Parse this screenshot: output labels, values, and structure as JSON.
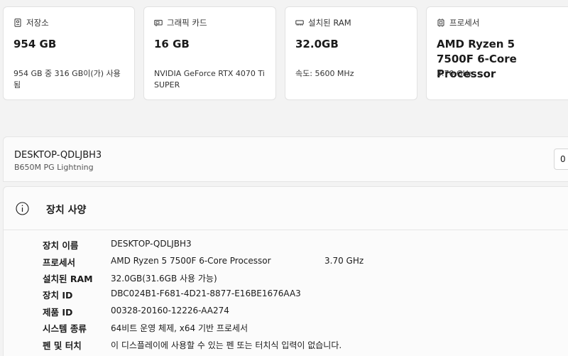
{
  "cards": [
    {
      "icon": "storage-icon",
      "title": "저장소",
      "value": "954 GB",
      "desc": "954 GB 중 316 GB이(가) 사용됨"
    },
    {
      "icon": "graphics-card-icon",
      "title": "그래픽 카드",
      "value": "16 GB",
      "desc": "NVIDIA GeForce RTX 4070 Ti SUPER"
    },
    {
      "icon": "ram-icon",
      "title": "설치된 RAM",
      "value": "32.0GB",
      "desc": "속도: 5600 MHz"
    },
    {
      "icon": "processor-icon",
      "title": "프로세서",
      "value": "AMD Ryzen 5 7500F 6-Core Processor",
      "desc": "3.70 GHz"
    }
  ],
  "device": {
    "name": "DESKTOP-QDLJBH3",
    "model": "B650M PG Lightning",
    "rename_label": "0"
  },
  "specs": {
    "title": "장치 사양",
    "rows": [
      {
        "label": "장치 이름",
        "value": "DESKTOP-QDLJBH3",
        "extra": ""
      },
      {
        "label": "프로세서",
        "value": "AMD Ryzen 5 7500F 6-Core Processor",
        "extra": "3.70 GHz"
      },
      {
        "label": "설치된 RAM",
        "value": "32.0GB(31.6GB 사용 가능)",
        "extra": ""
      },
      {
        "label": "장치 ID",
        "value": "DBC024B1-F681-4D21-8877-E16BE1676AA3",
        "extra": ""
      },
      {
        "label": "제품 ID",
        "value": "00328-20160-12226-AA274",
        "extra": ""
      },
      {
        "label": "시스템 종류",
        "value": "64비트 운영 체제, x64 기반 프로세서",
        "extra": ""
      },
      {
        "label": "펜 및 터치",
        "value": "이 디스플레이에 사용할 수 있는 펜 또는 터치식 입력이 없습니다.",
        "extra": ""
      }
    ]
  }
}
